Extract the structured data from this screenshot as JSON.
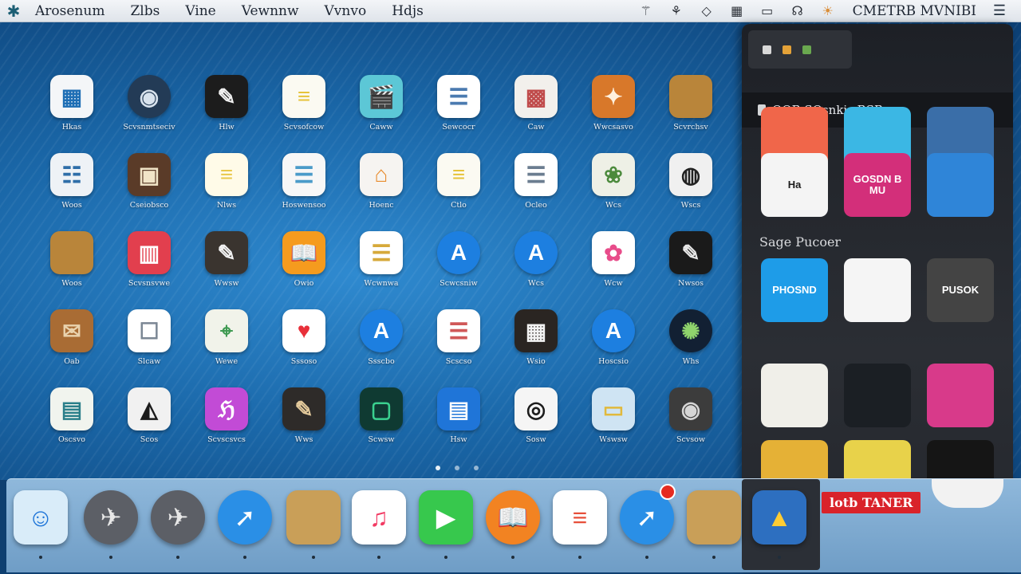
{
  "menubar": {
    "menus": [
      "Arosenum",
      "Zlbs",
      "Vine",
      "Vewnnw",
      "Vvnvo",
      "Hdjs"
    ],
    "status_text": "CMETRB MVNIBI",
    "status_icons": [
      "wand-icon",
      "butterfly-icon",
      "gem-icon",
      "calculator-icon",
      "display-icon",
      "headphones-icon",
      "lightbulb-icon"
    ]
  },
  "launchpad": {
    "apps": [
      {
        "label": "Hkas",
        "icon": "photo-editor-icon",
        "bg": "#f4f6f8",
        "fg": "#1f6fb5",
        "glyph": "▦"
      },
      {
        "label": "Scvsnmtseciv",
        "icon": "dark-circle-app-icon",
        "bg": "#233b56",
        "fg": "#d8e3ee",
        "glyph": "◉",
        "round": true
      },
      {
        "label": "Hlw",
        "icon": "script-app-icon",
        "bg": "#1c1c1c",
        "fg": "#f1f1f1",
        "glyph": "✎"
      },
      {
        "label": "Scvsofcow",
        "icon": "notes-icon",
        "bg": "#fbfaf2",
        "fg": "#e6c33a",
        "glyph": "≡"
      },
      {
        "label": "Caww",
        "icon": "clapperboard-icon",
        "bg": "#5cc7d6",
        "fg": "#111",
        "glyph": "🎬"
      },
      {
        "label": "Sewcocr",
        "icon": "reminders-icon",
        "bg": "#ffffff",
        "fg": "#4b7bb0",
        "glyph": "☰"
      },
      {
        "label": "Caw",
        "icon": "map-board-icon",
        "bg": "#f2f0ec",
        "fg": "#c04b4b",
        "glyph": "▩"
      },
      {
        "label": "Wwcsasvo",
        "icon": "orange-app-icon",
        "bg": "#d8782a",
        "fg": "#fff1de",
        "glyph": "✦"
      },
      {
        "label": "Scvrchsv",
        "icon": "wood-board-icon",
        "bg": "#b9853a",
        "fg": "#7b5420",
        "glyph": ""
      },
      {
        "label": "Woos",
        "icon": "finder-icon",
        "bg": "#eef2f6",
        "fg": "#2e6ea8",
        "glyph": "☷"
      },
      {
        "label": "Cseiobsco",
        "icon": "photo-frame-icon",
        "bg": "#5a3b28",
        "fg": "#f1e5c8",
        "glyph": "▣"
      },
      {
        "label": "Nlws",
        "icon": "notepad-icon",
        "bg": "#fffbe8",
        "fg": "#e9c84a",
        "glyph": "≡"
      },
      {
        "label": "Hoswensoo",
        "icon": "checklist-icon",
        "bg": "#f7f7f7",
        "fg": "#4a9bc9",
        "glyph": "☰"
      },
      {
        "label": "Hoenc",
        "icon": "home-icon",
        "bg": "#f6f4f1",
        "fg": "#e88b2d",
        "glyph": "⌂"
      },
      {
        "label": "Ctlo",
        "icon": "notes-icon",
        "bg": "#fbfaf2",
        "fg": "#e6c33a",
        "glyph": "≡"
      },
      {
        "label": "Ocleo",
        "icon": "reminders-icon",
        "bg": "#ffffff",
        "fg": "#6b7d90",
        "glyph": "☰"
      },
      {
        "label": "Wcs",
        "icon": "stickers-icon",
        "bg": "#eef0e6",
        "fg": "#4b8a3c",
        "glyph": "❀"
      },
      {
        "label": "Wscs",
        "icon": "clock-board-icon",
        "bg": "#f0f0f0",
        "fg": "#222",
        "glyph": "◍"
      },
      {
        "label": "Woos",
        "icon": "wood-board-icon",
        "bg": "#b9853a",
        "fg": "#7b5420",
        "glyph": ""
      },
      {
        "label": "Scvsnsvwe",
        "icon": "photo-booth-icon",
        "bg": "#e23f4e",
        "fg": "#fff",
        "glyph": "▥"
      },
      {
        "label": "Wwsw",
        "icon": "dark-app-icon",
        "bg": "#3a342f",
        "fg": "#f2f2f2",
        "glyph": "✎"
      },
      {
        "label": "Owio",
        "icon": "books-icon",
        "bg": "#f59b1e",
        "fg": "#fff",
        "glyph": "📖"
      },
      {
        "label": "Wcwnwa",
        "icon": "list-icon",
        "bg": "#ffffff",
        "fg": "#d6a93a",
        "glyph": "☰"
      },
      {
        "label": "Scwcsniw",
        "icon": "app-store-icon",
        "bg": "#1d7fe0",
        "fg": "#fff",
        "glyph": "A",
        "round": true
      },
      {
        "label": "Wcs",
        "icon": "app-store-icon",
        "bg": "#1d7fe0",
        "fg": "#fff",
        "glyph": "A",
        "round": true
      },
      {
        "label": "Wcw",
        "icon": "photos-icon",
        "bg": "#ffffff",
        "fg": "#e84c8a",
        "glyph": "✿"
      },
      {
        "label": "Nwsos",
        "icon": "black-sketch-icon",
        "bg": "#1a1a1a",
        "fg": "#e8e8e8",
        "glyph": "✎"
      },
      {
        "label": "Oab",
        "icon": "brown-notes-icon",
        "bg": "#a96c34",
        "fg": "#e9d2ad",
        "glyph": "✉"
      },
      {
        "label": "Slcaw",
        "icon": "document-icon",
        "bg": "#ffffff",
        "fg": "#7b8794",
        "glyph": "☐"
      },
      {
        "label": "Wewe",
        "icon": "maps-icon",
        "bg": "#f1f3ea",
        "fg": "#3f9a52",
        "glyph": "⌖"
      },
      {
        "label": "Sssoso",
        "icon": "health-heart-icon",
        "bg": "#ffffff",
        "fg": "#e8303a",
        "glyph": "♥"
      },
      {
        "label": "Ssscbo",
        "icon": "app-store-icon",
        "bg": "#1d7fe0",
        "fg": "#fff",
        "glyph": "A",
        "round": true
      },
      {
        "label": "Scscso",
        "icon": "reminders-icon",
        "bg": "#ffffff",
        "fg": "#d05858",
        "glyph": "☰"
      },
      {
        "label": "Wsio",
        "icon": "grid-app-icon",
        "bg": "#2a2522",
        "fg": "#f2f2f2",
        "glyph": "▦"
      },
      {
        "label": "Hoscsio",
        "icon": "app-store-icon",
        "bg": "#1d7fe0",
        "fg": "#fff",
        "glyph": "A",
        "round": true
      },
      {
        "label": "Whs",
        "icon": "green-bug-icon",
        "bg": "#122033",
        "fg": "#8fd46c",
        "glyph": "✺",
        "round": true
      },
      {
        "label": "Oscsvo",
        "icon": "map-chart-icon",
        "bg": "#f1f4ee",
        "fg": "#2b7f8a",
        "glyph": "▤"
      },
      {
        "label": "Scos",
        "icon": "eye-icon",
        "bg": "#f1f1f1",
        "fg": "#1c1c1c",
        "glyph": "◭"
      },
      {
        "label": "Scvscsvcs",
        "icon": "purple-app-icon",
        "bg": "#c24bd6",
        "fg": "#fff",
        "glyph": "ℌ"
      },
      {
        "label": "Wws",
        "icon": "sketch-icon",
        "bg": "#2e2b29",
        "fg": "#e3c99b",
        "glyph": "✎"
      },
      {
        "label": "Scwsw",
        "icon": "green-frame-icon",
        "bg": "#0f3a32",
        "fg": "#3ad08f",
        "glyph": "▢"
      },
      {
        "label": "Hsw",
        "icon": "blue-folder-icon",
        "bg": "#1f75d8",
        "fg": "#fff",
        "glyph": "▤"
      },
      {
        "label": "Sosw",
        "icon": "camera-icon",
        "bg": "#f5f5f5",
        "fg": "#1c1c1c",
        "glyph": "◎"
      },
      {
        "label": "Wswsw",
        "icon": "preview-icon",
        "bg": "#cfe4f3",
        "fg": "#e1b93c",
        "glyph": "▭"
      },
      {
        "label": "Scvsow",
        "icon": "dark-circle-app-icon",
        "bg": "#3c3c3c",
        "fg": "#d5d5d5",
        "glyph": "◉"
      }
    ],
    "page_count": 3,
    "active_page": 0
  },
  "panel": {
    "header": "OOB SOsnkis BSBs",
    "section_title": "Sage Pucoer",
    "tiles": [
      {
        "icon": "colorful-stripes-icon",
        "bg": "#f0664a",
        "text": ""
      },
      {
        "icon": "blue-waves-icon",
        "bg": "#3bb7e4",
        "text": ""
      },
      {
        "icon": "circle-pattern-icon",
        "bg": "#3a6ea8",
        "text": ""
      },
      {
        "icon": "notepad-dark-icon",
        "bg": "#f4f4f4",
        "text": "Ha"
      },
      {
        "icon": "pink-banner-icon",
        "bg": "#d32f7a",
        "text": "GOSDN B MU"
      },
      {
        "icon": "rainbow-icon",
        "bg": "#2f85d8",
        "text": ""
      },
      {
        "icon": "yellow-blue-icon",
        "bg": "#1e9ce8",
        "text": "PHOSND"
      },
      {
        "icon": "white-box-icon",
        "bg": "#f5f5f5",
        "text": ""
      },
      {
        "icon": "pencil-box-icon",
        "bg": "#444",
        "text": "PUSOK"
      },
      {
        "icon": "document-grid-icon",
        "bg": "#f0efe9",
        "text": ""
      },
      {
        "icon": "dark-cyan-icon",
        "bg": "#1b1f24",
        "text": ""
      },
      {
        "icon": "pink-magenta-icon",
        "bg": "#d83a8a",
        "text": ""
      },
      {
        "icon": "collage-icon",
        "bg": "#e5b136",
        "text": ""
      },
      {
        "icon": "comic-icon",
        "bg": "#e8d24a",
        "text": ""
      },
      {
        "icon": "dark-swirl-icon",
        "bg": "#151515",
        "text": ""
      }
    ]
  },
  "dock": {
    "apps": [
      {
        "name": "finder-icon",
        "bg": "#d9ecf9",
        "fg": "#1f75d8",
        "glyph": "☺"
      },
      {
        "name": "launchpad-icon",
        "bg": "#5c5f66",
        "fg": "#e7e7e7",
        "glyph": "✈",
        "round": true
      },
      {
        "name": "launchpad-icon",
        "bg": "#5c5f66",
        "fg": "#e7e7e7",
        "glyph": "✈",
        "round": true
      },
      {
        "name": "safari-icon",
        "bg": "#2a8fe6",
        "fg": "#ffffff",
        "glyph": "➚",
        "round": true
      },
      {
        "name": "notebook-icon",
        "bg": "#c99f58",
        "fg": "#8a6a32",
        "glyph": ""
      },
      {
        "name": "music-icon",
        "bg": "#ffffff",
        "fg": "#f23a63",
        "glyph": "♫"
      },
      {
        "name": "facetime-icon",
        "bg": "#37c84d",
        "fg": "#ffffff",
        "glyph": "▶"
      },
      {
        "name": "books-icon",
        "bg": "#f28322",
        "fg": "#ffffff",
        "glyph": "📖",
        "round": true
      },
      {
        "name": "reminders-icon",
        "bg": "#ffffff",
        "fg": "#e74f3a",
        "glyph": "≡"
      },
      {
        "name": "safari-icon",
        "bg": "#2a8fe6",
        "fg": "#ffffff",
        "glyph": "➚",
        "round": true,
        "badge": true
      },
      {
        "name": "notebook-icon",
        "bg": "#c99f58",
        "fg": "#8a6a32",
        "glyph": ""
      },
      {
        "name": "image-preview-icon",
        "bg": "#2d6fc0",
        "fg": "#ffcc33",
        "glyph": "▲"
      }
    ],
    "tray_label": "lotb TANER"
  }
}
